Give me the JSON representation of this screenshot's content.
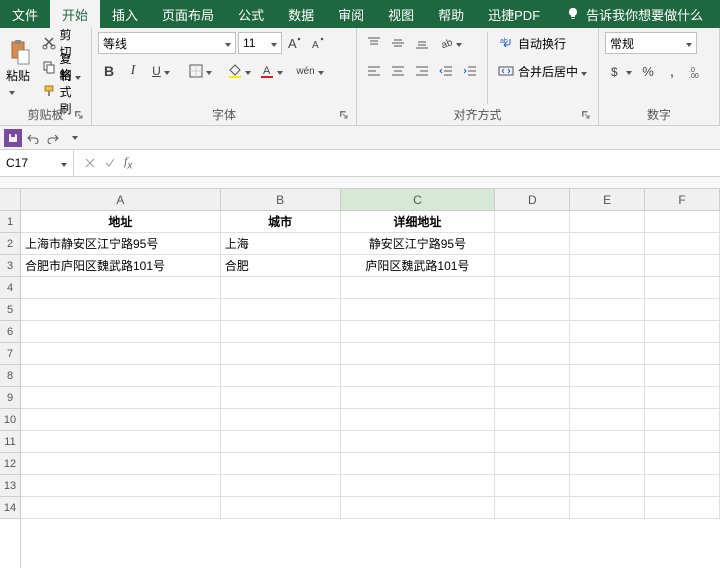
{
  "tabs": {
    "file": "文件",
    "home": "开始",
    "insert": "插入",
    "layout": "页面布局",
    "formulas": "公式",
    "data": "数据",
    "review": "审阅",
    "view": "视图",
    "help": "帮助",
    "xunjie": "迅捷PDF"
  },
  "tellme": "告诉我你想要做什么",
  "clipboard": {
    "cut": "剪切",
    "copy": "复制",
    "fmt": "格式刷",
    "paste": "粘贴",
    "label": "剪贴板"
  },
  "font": {
    "name": "等线",
    "size": "11",
    "wen": "wén",
    "label": "字体"
  },
  "align": {
    "wrap": "自动换行",
    "merge": "合并后居中",
    "label": "对齐方式"
  },
  "number": {
    "fmt": "常规",
    "label": "数字"
  },
  "namebox": "C17",
  "cols": {
    "widths": [
      200,
      120,
      155,
      75,
      75,
      75
    ]
  },
  "headers": [
    "A",
    "B",
    "C",
    "D",
    "E",
    "F"
  ],
  "data": {
    "r1": {
      "a": "地址",
      "b": "城市",
      "c": "详细地址"
    },
    "r2": {
      "a": "上海市静安区江宁路95号",
      "b": "上海",
      "c": "静安区江宁路95号"
    },
    "r3": {
      "a": "合肥市庐阳区魏武路101号",
      "b": "合肥",
      "c": "庐阳区魏武路101号"
    }
  }
}
